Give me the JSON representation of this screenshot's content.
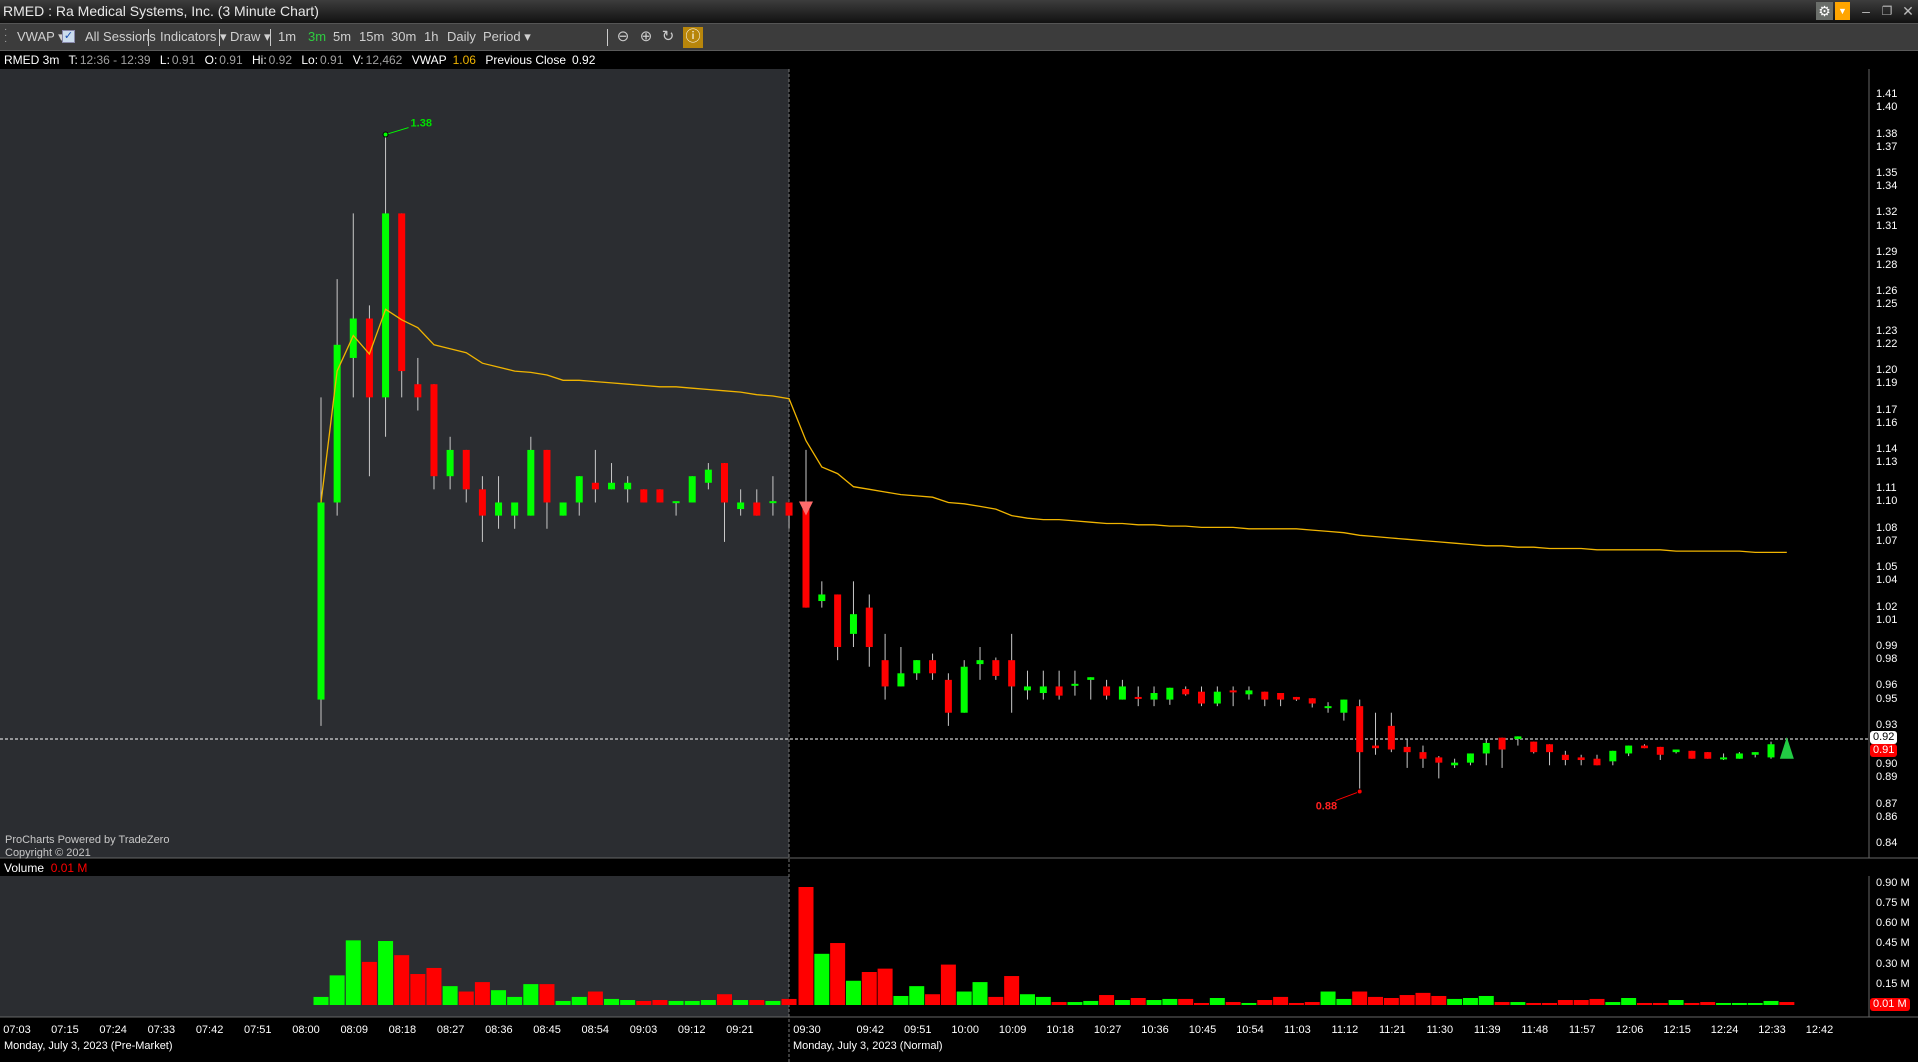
{
  "window": {
    "title": "RMED : Ra Medical Systems, Inc. (3 Minute Chart)",
    "buttons": [
      "gear-icon",
      "dropdown-icon",
      "minimize-icon",
      "restore-icon",
      "close-icon"
    ]
  },
  "toolbar": {
    "vwap": "VWAP ▾",
    "all_sessions": "All Sessions",
    "all_sessions_checked": true,
    "indicators": "Indicators ▾",
    "draw": "Draw ▾",
    "timeframes": [
      "1m",
      "3m",
      "5m",
      "15m",
      "30m",
      "1h",
      "Daily"
    ],
    "active_timeframe": "3m",
    "period": "Period ▾",
    "icons": [
      "zoom-out-icon",
      "zoom-in-icon",
      "reset-zoom-icon",
      "auto-scale-icon"
    ]
  },
  "info": {
    "symbol": "RMED 3m",
    "t_label": "T:",
    "t_value": "12:36 - 12:39",
    "l_label": "L:",
    "l_value": "0.91",
    "o_label": "O:",
    "o_value": "0.91",
    "hi_label": "Hi:",
    "hi_value": "0.92",
    "lo_label": "Lo:",
    "lo_value": "0.91",
    "v_label": "V:",
    "v_value": "12,462",
    "vwap_label": "VWAP",
    "vwap_value": "1.06",
    "prev_label": "Previous Close",
    "prev_value": "0.92"
  },
  "watermark": {
    "line1": "ProCharts Powered by TradeZero",
    "line2": "Copyright © 2021"
  },
  "volume_pane": {
    "label": "Volume",
    "value": "0.01 M",
    "axis": [
      "0.90 M",
      "0.75 M",
      "0.60 M",
      "0.45 M",
      "0.30 M",
      "0.15 M"
    ],
    "badge": "0.01 M"
  },
  "colors": {
    "up": "#00ff00",
    "down": "#ff0000",
    "wick": "#c8c8c8",
    "vwap": "#f0b400",
    "premarket_bg": "#2b2d31",
    "accent": "#b8860b"
  },
  "chart_data": {
    "type": "candlestick",
    "ylim": [
      0.84,
      1.41
    ],
    "price_axis": [
      "1.41",
      "1.40",
      "1.38",
      "1.37",
      "1.35",
      "1.34",
      "1.32",
      "1.31",
      "1.29",
      "1.28",
      "1.26",
      "1.25",
      "1.23",
      "1.22",
      "1.20",
      "1.19",
      "1.17",
      "1.16",
      "1.14",
      "1.13",
      "1.11",
      "1.10",
      "1.08",
      "1.07",
      "1.05",
      "1.04",
      "1.02",
      "1.01",
      "0.99",
      "0.98",
      "0.96",
      "0.95",
      "0.93",
      "0.90",
      "0.89",
      "0.87",
      "0.86",
      "0.84"
    ],
    "last_price": "0.91",
    "previous_close": "0.92",
    "previous_close_value": 0.92,
    "high_label": "1.38",
    "high_value": 1.38,
    "low_label": "0.88",
    "low_value": 0.88,
    "time_labels_pre": [
      "07:03",
      "07:15",
      "07:24",
      "07:33",
      "07:42",
      "07:51",
      "08:00",
      "08:09",
      "08:18",
      "08:27",
      "08:36",
      "08:45",
      "08:54",
      "09:03",
      "09:12",
      "09:21"
    ],
    "time_labels_post": [
      "09:30",
      "09:42",
      "09:51",
      "10:00",
      "10:09",
      "10:18",
      "10:27",
      "10:36",
      "10:45",
      "10:54",
      "11:03",
      "11:12",
      "11:21",
      "11:30",
      "11:39",
      "11:48",
      "11:57",
      "12:06",
      "12:15",
      "12:24",
      "12:33",
      "12:42"
    ],
    "date_pre": "Monday, July 3, 2023 (Pre-Market)",
    "date_post": "Monday, July 3, 2023 (Normal)",
    "columns": [
      "time",
      "open",
      "high",
      "low",
      "close",
      "volume_M",
      "vwap"
    ],
    "pre": [
      [
        "08:00",
        0.95,
        1.18,
        0.93,
        1.1,
        0.06,
        1.1
      ],
      [
        "08:03",
        1.1,
        1.27,
        1.09,
        1.22,
        0.22,
        1.2
      ],
      [
        "08:06",
        1.21,
        1.32,
        1.18,
        1.24,
        0.48,
        1.227
      ],
      [
        "08:09",
        1.24,
        1.25,
        1.12,
        1.18,
        0.32,
        1.213
      ],
      [
        "08:12",
        1.18,
        1.38,
        1.15,
        1.32,
        0.475,
        1.247
      ],
      [
        "08:15",
        1.32,
        1.32,
        1.18,
        1.2,
        0.37,
        1.239
      ],
      [
        "08:18",
        1.19,
        1.21,
        1.17,
        1.18,
        0.23,
        1.233
      ],
      [
        "08:21",
        1.19,
        1.19,
        1.11,
        1.12,
        0.275,
        1.22
      ],
      [
        "08:24",
        1.12,
        1.15,
        1.11,
        1.14,
        0.14,
        1.217
      ],
      [
        "08:27",
        1.14,
        1.14,
        1.1,
        1.11,
        0.1,
        1.214
      ],
      [
        "08:30",
        1.11,
        1.12,
        1.07,
        1.09,
        0.17,
        1.206
      ],
      [
        "08:33",
        1.09,
        1.12,
        1.08,
        1.1,
        0.11,
        1.203
      ],
      [
        "08:36",
        1.09,
        1.1,
        1.08,
        1.1,
        0.06,
        1.2
      ],
      [
        "08:39",
        1.09,
        1.15,
        1.09,
        1.14,
        0.155,
        1.199
      ],
      [
        "08:42",
        1.14,
        1.14,
        1.08,
        1.1,
        0.155,
        1.197
      ],
      [
        "08:45",
        1.09,
        1.1,
        1.09,
        1.1,
        0.03,
        1.193
      ],
      [
        "08:48",
        1.1,
        1.12,
        1.09,
        1.12,
        0.06,
        1.193
      ],
      [
        "08:51",
        1.115,
        1.14,
        1.1,
        1.11,
        0.1,
        1.192
      ],
      [
        "08:54",
        1.11,
        1.13,
        1.11,
        1.115,
        0.045,
        1.191
      ],
      [
        "08:57",
        1.11,
        1.12,
        1.1,
        1.115,
        0.037,
        1.19
      ],
      [
        "09:00",
        1.11,
        1.11,
        1.1,
        1.1,
        0.03,
        1.189
      ],
      [
        "09:03",
        1.11,
        1.11,
        1.1,
        1.1,
        0.037,
        1.188
      ],
      [
        "09:06",
        1.1,
        1.1,
        1.09,
        1.101,
        0.03,
        1.188
      ],
      [
        "09:09",
        1.1,
        1.12,
        1.1,
        1.12,
        0.03,
        1.187
      ],
      [
        "09:12",
        1.115,
        1.13,
        1.11,
        1.125,
        0.037,
        1.186
      ],
      [
        "09:15",
        1.13,
        1.13,
        1.07,
        1.1,
        0.08,
        1.185
      ],
      [
        "09:18",
        1.095,
        1.11,
        1.09,
        1.1,
        0.037,
        1.184
      ],
      [
        "09:21",
        1.1,
        1.11,
        1.09,
        1.09,
        0.037,
        1.182
      ],
      [
        "09:24",
        1.1,
        1.12,
        1.09,
        1.101,
        0.03,
        1.181
      ],
      [
        "09:27",
        1.1,
        1.1,
        1.08,
        1.09,
        0.045,
        1.179
      ]
    ],
    "post": [
      [
        "09:30",
        1.1,
        1.14,
        1.02,
        1.02,
        0.876,
        1.147
      ],
      [
        "09:33",
        1.025,
        1.04,
        1.02,
        1.03,
        0.38,
        1.127
      ],
      [
        "09:36",
        1.03,
        1.03,
        0.98,
        0.99,
        0.46,
        1.122
      ],
      [
        "09:39",
        1.0,
        1.04,
        0.99,
        1.015,
        0.18,
        1.112
      ],
      [
        "09:42",
        1.02,
        1.03,
        0.975,
        0.99,
        0.245,
        1.11
      ],
      [
        "09:45",
        0.98,
        1.0,
        0.95,
        0.96,
        0.27,
        1.108
      ],
      [
        "09:48",
        0.96,
        0.99,
        0.96,
        0.97,
        0.067,
        1.106
      ],
      [
        "09:51",
        0.97,
        0.98,
        0.965,
        0.98,
        0.14,
        1.105
      ],
      [
        "09:54",
        0.98,
        0.985,
        0.965,
        0.97,
        0.08,
        1.104
      ],
      [
        "09:57",
        0.965,
        0.97,
        0.93,
        0.94,
        0.3,
        1.1
      ],
      [
        "10:00",
        0.94,
        0.98,
        0.94,
        0.975,
        0.1,
        1.099
      ],
      [
        "10:03",
        0.977,
        0.99,
        0.965,
        0.98,
        0.17,
        1.097
      ],
      [
        "10:06",
        0.98,
        0.982,
        0.965,
        0.968,
        0.06,
        1.095
      ],
      [
        "10:09",
        0.98,
        1.0,
        0.94,
        0.96,
        0.215,
        1.09
      ],
      [
        "10:12",
        0.957,
        0.972,
        0.95,
        0.96,
        0.08,
        1.088
      ],
      [
        "10:15",
        0.955,
        0.972,
        0.95,
        0.96,
        0.06,
        1.087
      ],
      [
        "10:18",
        0.96,
        0.972,
        0.95,
        0.953,
        0.022,
        1.087
      ],
      [
        "10:21",
        0.961,
        0.972,
        0.953,
        0.962,
        0.022,
        1.086
      ],
      [
        "10:24",
        0.965,
        0.967,
        0.95,
        0.967,
        0.03,
        1.085
      ],
      [
        "10:27",
        0.96,
        0.965,
        0.95,
        0.953,
        0.074,
        1.084
      ],
      [
        "10:30",
        0.95,
        0.965,
        0.95,
        0.96,
        0.037,
        1.084
      ],
      [
        "10:33",
        0.952,
        0.96,
        0.945,
        0.951,
        0.052,
        1.083
      ],
      [
        "10:36",
        0.95,
        0.96,
        0.945,
        0.955,
        0.037,
        1.083
      ],
      [
        "10:39",
        0.95,
        0.959,
        0.946,
        0.959,
        0.045,
        1.082
      ],
      [
        "10:42",
        0.958,
        0.96,
        0.953,
        0.954,
        0.045,
        1.082
      ],
      [
        "10:45",
        0.956,
        0.96,
        0.945,
        0.947,
        0.015,
        1.081
      ],
      [
        "10:48",
        0.947,
        0.96,
        0.945,
        0.956,
        0.052,
        1.081
      ],
      [
        "10:51",
        0.957,
        0.96,
        0.945,
        0.956,
        0.022,
        1.081
      ],
      [
        "10:54",
        0.954,
        0.96,
        0.95,
        0.957,
        0.015,
        1.08
      ],
      [
        "10:57",
        0.956,
        0.956,
        0.945,
        0.95,
        0.037,
        1.08
      ],
      [
        "11:00",
        0.955,
        0.955,
        0.945,
        0.95,
        0.06,
        1.08
      ],
      [
        "11:03",
        0.952,
        0.952,
        0.949,
        0.95,
        0.015,
        1.08
      ],
      [
        "11:06",
        0.951,
        0.951,
        0.944,
        0.947,
        0.022,
        1.079
      ],
      [
        "11:09",
        0.944,
        0.948,
        0.94,
        0.945,
        0.1,
        1.078
      ],
      [
        "11:12",
        0.94,
        0.95,
        0.934,
        0.95,
        0.045,
        1.077
      ],
      [
        "11:15",
        0.945,
        0.95,
        0.88,
        0.91,
        0.1,
        1.075
      ],
      [
        "11:18",
        0.915,
        0.94,
        0.908,
        0.913,
        0.06,
        1.074
      ],
      [
        "11:21",
        0.93,
        0.94,
        0.91,
        0.912,
        0.052,
        1.073
      ],
      [
        "11:24",
        0.914,
        0.92,
        0.898,
        0.91,
        0.074,
        1.072
      ],
      [
        "11:27",
        0.91,
        0.915,
        0.898,
        0.905,
        0.09,
        1.071
      ],
      [
        "11:30",
        0.906,
        0.907,
        0.89,
        0.902,
        0.067,
        1.07
      ],
      [
        "11:33",
        0.9,
        0.905,
        0.898,
        0.902,
        0.045,
        1.069
      ],
      [
        "11:36",
        0.902,
        0.909,
        0.9,
        0.909,
        0.052,
        1.068
      ],
      [
        "11:39",
        0.909,
        0.92,
        0.9,
        0.917,
        0.067,
        1.067
      ],
      [
        "11:42",
        0.921,
        0.921,
        0.898,
        0.912,
        0.022,
        1.067
      ],
      [
        "11:45",
        0.92,
        0.922,
        0.915,
        0.922,
        0.022,
        1.066
      ],
      [
        "11:48",
        0.918,
        0.918,
        0.909,
        0.91,
        0.015,
        1.066
      ],
      [
        "11:51",
        0.916,
        0.916,
        0.9,
        0.91,
        0.015,
        1.065
      ],
      [
        "11:54",
        0.908,
        0.911,
        0.9,
        0.904,
        0.037,
        1.065
      ],
      [
        "11:57",
        0.906,
        0.908,
        0.9,
        0.904,
        0.037,
        1.065
      ],
      [
        "12:00",
        0.905,
        0.908,
        0.9,
        0.9,
        0.045,
        1.064
      ],
      [
        "12:03",
        0.903,
        0.911,
        0.9,
        0.911,
        0.022,
        1.064
      ],
      [
        "12:06",
        0.909,
        0.915,
        0.907,
        0.915,
        0.052,
        1.064
      ],
      [
        "12:09",
        0.915,
        0.916,
        0.913,
        0.913,
        0.015,
        1.064
      ],
      [
        "12:12",
        0.914,
        0.914,
        0.904,
        0.908,
        0.015,
        1.064
      ],
      [
        "12:15",
        0.91,
        0.912,
        0.909,
        0.912,
        0.037,
        1.063
      ],
      [
        "12:18",
        0.911,
        0.911,
        0.905,
        0.905,
        0.015,
        1.063
      ],
      [
        "12:21",
        0.91,
        0.91,
        0.905,
        0.905,
        0.022,
        1.063
      ],
      [
        "12:24",
        0.905,
        0.909,
        0.904,
        0.906,
        0.015,
        1.063
      ],
      [
        "12:27",
        0.905,
        0.91,
        0.905,
        0.909,
        0.015,
        1.063
      ],
      [
        "12:30",
        0.908,
        0.91,
        0.906,
        0.91,
        0.015,
        1.062
      ],
      [
        "12:33",
        0.906,
        0.918,
        0.905,
        0.916,
        0.03,
        1.062
      ],
      [
        "12:36",
        0.912,
        0.92,
        0.908,
        0.91,
        0.022,
        1.062
      ]
    ]
  }
}
